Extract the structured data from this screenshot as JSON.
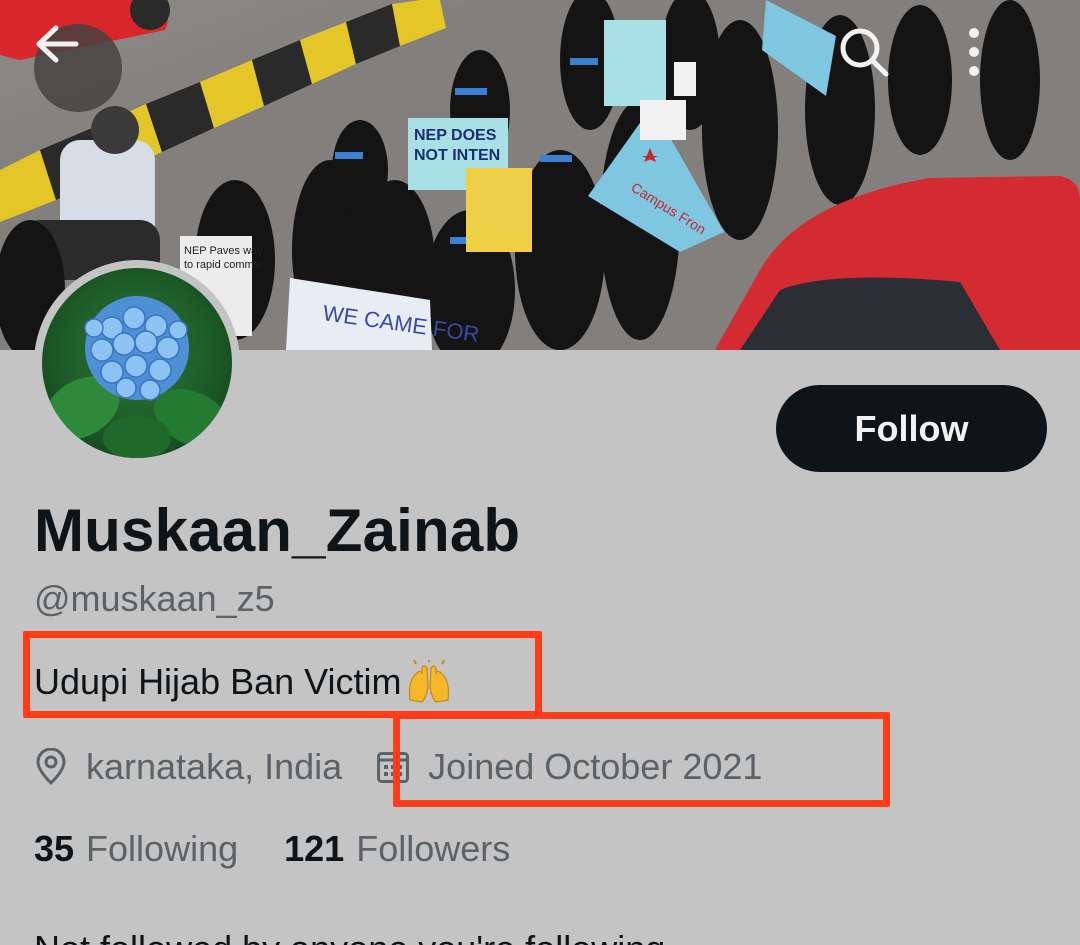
{
  "header": {
    "back_icon": "arrow-left-icon",
    "search_icon": "search-icon",
    "more_icon": "more-vertical-icon"
  },
  "banner": {
    "description_icon": "protest-photo",
    "sign_texts": [
      "NEP DOES NOT INTEN",
      "WE CAME FOR",
      "Campus Fron",
      "NEP Paves way to rapid commercialisation"
    ]
  },
  "profile": {
    "display_name": "Muskaan_Zainab",
    "handle": "@muskaan_z5",
    "follow_label": "Follow",
    "bio": "Udupi Hijab Ban Victim",
    "bio_emoji": "raising-hands-emoji",
    "location": "karnataka, India",
    "joined": "Joined October 2021",
    "following_count": "35",
    "following_label": "Following",
    "followers_count": "121",
    "followers_label": "Followers",
    "cut_off_line": "Not followed by anyone you're following"
  },
  "colors": {
    "background": "#c4c4c4",
    "text_primary": "#0f1419",
    "text_secondary": "#5b6268",
    "follow_button": "#0f1419",
    "highlight": "#ff3b1a"
  }
}
